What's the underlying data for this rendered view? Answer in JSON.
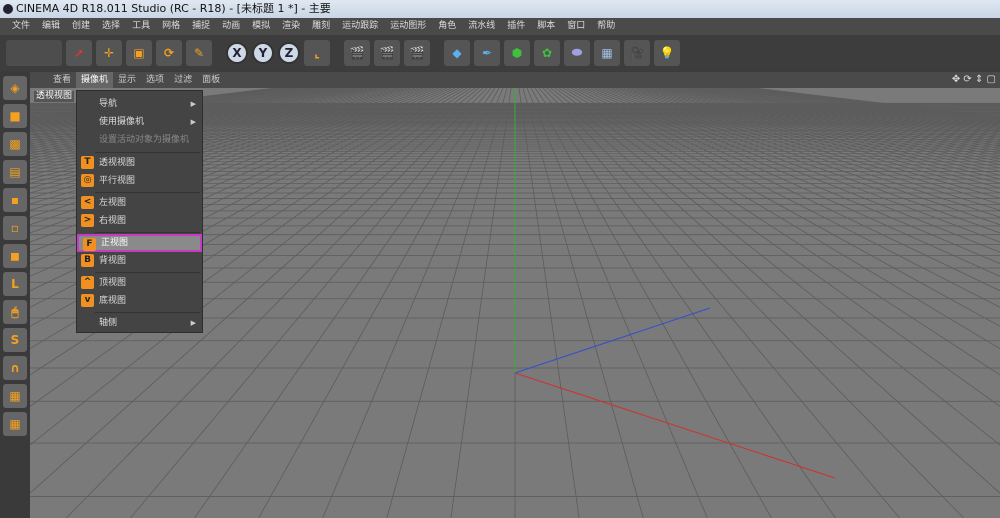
{
  "title": "CINEMA 4D R18.011 Studio (RC - R18) - [未标题 1 *] - 主要",
  "menubar": [
    "文件",
    "编辑",
    "创建",
    "选择",
    "工具",
    "网格",
    "捕捉",
    "动画",
    "模拟",
    "渲染",
    "雕刻",
    "运动跟踪",
    "运动图形",
    "角色",
    "流水线",
    "插件",
    "脚本",
    "窗口",
    "帮助"
  ],
  "toolbar": {
    "axes": [
      "X",
      "Y",
      "Z"
    ]
  },
  "viewport": {
    "menu": [
      "查看",
      "摄像机",
      "显示",
      "选项",
      "过滤",
      "面板"
    ],
    "active_menu": "摄像机",
    "label": "透视视图",
    "nav_icons": "✥ ⟳ ⇕ ▢"
  },
  "camera_menu": {
    "items": [
      {
        "label": "导航",
        "submenu": true
      },
      {
        "label": "使用摄像机",
        "submenu": true
      },
      {
        "label": "设置活动对象为摄像机",
        "disabled": true
      },
      {
        "label": "透视视图",
        "icon": "T"
      },
      {
        "label": "平行视图",
        "icon": "◎"
      },
      {
        "label": "左视图",
        "icon": "<"
      },
      {
        "label": "右视图",
        "icon": ">"
      },
      {
        "label": "正视图",
        "icon": "F",
        "highlighted": true
      },
      {
        "label": "背视图",
        "icon": "B"
      },
      {
        "label": "顶视图",
        "icon": "^"
      },
      {
        "label": "底视图",
        "icon": "v"
      },
      {
        "label": "轴侧",
        "submenu": true
      }
    ]
  },
  "colors": {
    "highlight_border": "#c43bc4",
    "icon_orange": "#f09020",
    "x_axis": "#d03030",
    "y_axis": "#30b030",
    "z_axis": "#3050d0"
  }
}
